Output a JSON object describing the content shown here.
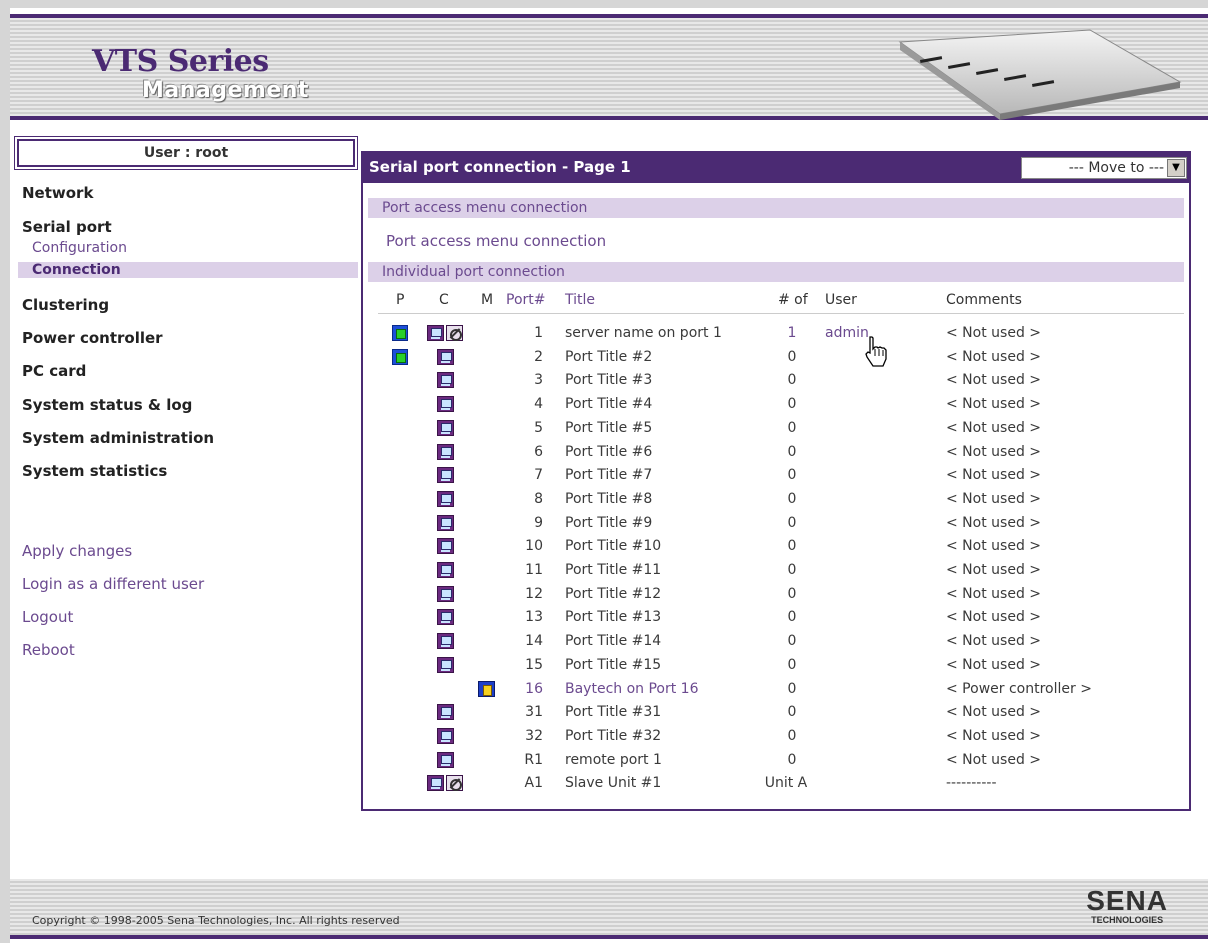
{
  "header": {
    "logo_title": "VTS Series",
    "logo_subtitle": "Management"
  },
  "sidebar": {
    "user_label": "User : root",
    "items": [
      {
        "label": "Network"
      },
      {
        "label": "Serial port"
      },
      {
        "label": "Clustering"
      },
      {
        "label": "Power controller"
      },
      {
        "label": "PC card"
      },
      {
        "label": "System status & log"
      },
      {
        "label": "System administration"
      },
      {
        "label": "System statistics"
      }
    ],
    "serial_sub": [
      {
        "label": "Configuration"
      },
      {
        "label": "Connection"
      }
    ],
    "links": [
      {
        "label": "Apply changes"
      },
      {
        "label": "Login as a different user"
      },
      {
        "label": "Logout"
      },
      {
        "label": "Reboot"
      }
    ]
  },
  "panel": {
    "title": "Serial port connection - Page 1",
    "move_to": "--- Move to ---",
    "section_menu": "Port access menu connection",
    "menu_link": "Port access menu connection",
    "section_individual": "Individual port connection",
    "columns": {
      "p": "P",
      "c": "C",
      "m": "M",
      "port": "Port#",
      "title": "Title",
      "count": "# of",
      "user": "User",
      "comments": "Comments"
    },
    "rows": [
      {
        "p": true,
        "c": true,
        "x": true,
        "m": false,
        "port": "1",
        "title": "server name on port 1",
        "count": "1",
        "user": "admin",
        "comment": "< Not used >"
      },
      {
        "p": true,
        "c": true,
        "x": false,
        "m": false,
        "port": "2",
        "title": "Port Title #2",
        "count": "0",
        "user": "",
        "comment": "< Not used >"
      },
      {
        "p": false,
        "c": true,
        "x": false,
        "m": false,
        "port": "3",
        "title": "Port Title #3",
        "count": "0",
        "user": "",
        "comment": "< Not used >"
      },
      {
        "p": false,
        "c": true,
        "x": false,
        "m": false,
        "port": "4",
        "title": "Port Title #4",
        "count": "0",
        "user": "",
        "comment": "< Not used >"
      },
      {
        "p": false,
        "c": true,
        "x": false,
        "m": false,
        "port": "5",
        "title": "Port Title #5",
        "count": "0",
        "user": "",
        "comment": "< Not used >"
      },
      {
        "p": false,
        "c": true,
        "x": false,
        "m": false,
        "port": "6",
        "title": "Port Title #6",
        "count": "0",
        "user": "",
        "comment": "< Not used >"
      },
      {
        "p": false,
        "c": true,
        "x": false,
        "m": false,
        "port": "7",
        "title": "Port Title #7",
        "count": "0",
        "user": "",
        "comment": "< Not used >"
      },
      {
        "p": false,
        "c": true,
        "x": false,
        "m": false,
        "port": "8",
        "title": "Port Title #8",
        "count": "0",
        "user": "",
        "comment": "< Not used >"
      },
      {
        "p": false,
        "c": true,
        "x": false,
        "m": false,
        "port": "9",
        "title": "Port Title #9",
        "count": "0",
        "user": "",
        "comment": "< Not used >"
      },
      {
        "p": false,
        "c": true,
        "x": false,
        "m": false,
        "port": "10",
        "title": "Port Title #10",
        "count": "0",
        "user": "",
        "comment": "< Not used >"
      },
      {
        "p": false,
        "c": true,
        "x": false,
        "m": false,
        "port": "11",
        "title": "Port Title #11",
        "count": "0",
        "user": "",
        "comment": "< Not used >"
      },
      {
        "p": false,
        "c": true,
        "x": false,
        "m": false,
        "port": "12",
        "title": "Port Title #12",
        "count": "0",
        "user": "",
        "comment": "< Not used >"
      },
      {
        "p": false,
        "c": true,
        "x": false,
        "m": false,
        "port": "13",
        "title": "Port Title #13",
        "count": "0",
        "user": "",
        "comment": "< Not used >"
      },
      {
        "p": false,
        "c": true,
        "x": false,
        "m": false,
        "port": "14",
        "title": "Port Title #14",
        "count": "0",
        "user": "",
        "comment": "< Not used >"
      },
      {
        "p": false,
        "c": true,
        "x": false,
        "m": false,
        "port": "15",
        "title": "Port Title #15",
        "count": "0",
        "user": "",
        "comment": "< Not used >"
      },
      {
        "p": false,
        "c": false,
        "x": false,
        "m": true,
        "port": "16",
        "title": "Baytech on Port 16",
        "count": "0",
        "user": "",
        "comment": "< Power controller >"
      },
      {
        "p": false,
        "c": true,
        "x": false,
        "m": false,
        "port": "31",
        "title": "Port Title #31",
        "count": "0",
        "user": "",
        "comment": "< Not used >"
      },
      {
        "p": false,
        "c": true,
        "x": false,
        "m": false,
        "port": "32",
        "title": "Port Title #32",
        "count": "0",
        "user": "",
        "comment": "< Not used >"
      },
      {
        "p": false,
        "c": true,
        "x": false,
        "m": false,
        "port": "R1",
        "title": "remote port 1",
        "count": "0",
        "user": "",
        "comment": "< Not used >"
      },
      {
        "p": false,
        "c": true,
        "x": true,
        "m": false,
        "port": "A1",
        "title": "Slave Unit #1",
        "count": "Unit A",
        "user": "",
        "comment": "----------"
      }
    ]
  },
  "footer": {
    "copyright": "Copyright © 1998-2005 Sena Technologies, Inc. All rights reserved",
    "brand": "SENA",
    "brand_sub": "TECHNOLOGIES"
  },
  "colors": {
    "accent": "#4b2a73",
    "link": "#6b4a8f",
    "section_bg": "#dcd0e8"
  }
}
